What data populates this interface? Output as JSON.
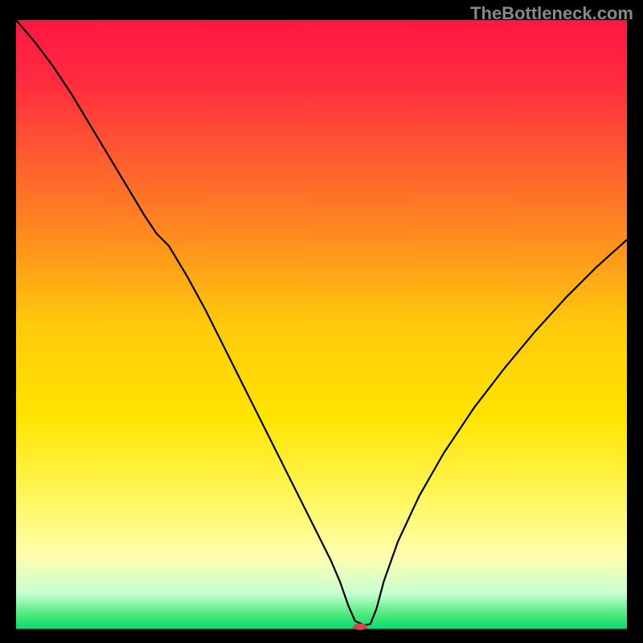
{
  "watermark": "TheBottleneck.com",
  "chart_data": {
    "type": "line",
    "title": "",
    "xlabel": "",
    "ylabel": "",
    "xlim": [
      0,
      100
    ],
    "ylim": [
      0,
      100
    ],
    "legend": false,
    "annotations": [],
    "gradient_stops": [
      {
        "offset": 0.0,
        "color": "#ff1744"
      },
      {
        "offset": 0.1,
        "color": "#ff2b3f"
      },
      {
        "offset": 0.22,
        "color": "#ff5a30"
      },
      {
        "offset": 0.35,
        "color": "#ff8a1f"
      },
      {
        "offset": 0.5,
        "color": "#ffca0c"
      },
      {
        "offset": 0.65,
        "color": "#ffe400"
      },
      {
        "offset": 0.78,
        "color": "#fff65a"
      },
      {
        "offset": 0.88,
        "color": "#ffffb0"
      },
      {
        "offset": 0.94,
        "color": "#c6ffd0"
      },
      {
        "offset": 0.975,
        "color": "#4be87a"
      },
      {
        "offset": 1.0,
        "color": "#00d973"
      }
    ],
    "series": [
      {
        "name": "bottleneck_curve",
        "color": "#000000",
        "width": 2.2,
        "x": [
          0.0,
          3.0,
          6.0,
          9.0,
          12.0,
          15.0,
          18.0,
          21.0,
          23.0,
          25.0,
          28.0,
          31.0,
          34.0,
          37.0,
          40.0,
          43.0,
          46.0,
          49.0,
          51.5,
          53.0,
          54.4,
          55.5,
          57.0,
          58.0,
          59.0,
          60.2,
          62.5,
          66.0,
          70.0,
          75.0,
          80.0,
          85.0,
          90.0,
          95.0,
          100.0
        ],
        "y": [
          100.0,
          96.5,
          92.5,
          88.0,
          83.0,
          78.0,
          73.0,
          68.0,
          65.0,
          63.0,
          58.0,
          52.5,
          46.5,
          40.5,
          34.5,
          28.5,
          22.5,
          16.5,
          11.5,
          8.0,
          4.0,
          1.5,
          0.8,
          1.0,
          3.5,
          8.0,
          14.5,
          22.0,
          29.0,
          36.5,
          43.0,
          49.0,
          54.5,
          59.5,
          64.0
        ]
      }
    ],
    "marker": {
      "name": "optimal_point",
      "x": 56.3,
      "y": 0.55,
      "rx": 1.15,
      "ry": 0.55,
      "color": "#d14a4a"
    }
  }
}
